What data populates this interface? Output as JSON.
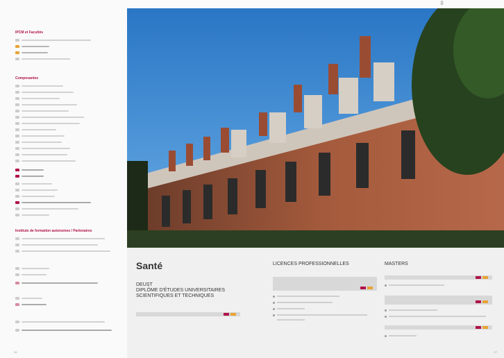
{
  "left_page": {
    "section_titles": [
      "IPCM et Facultés",
      "Composantes",
      "Instituts de formation autonomes / Partenaires"
    ],
    "page_number": "26"
  },
  "right_page": {
    "title": "Santé",
    "deust_heading": "DEUST\nDIPLÔME D'ÉTUDES UNIVERSITAIRES SCIENTIFIQUES ET TECHNIQUES",
    "col_licences": "LICENCES PROFESSIONNELLES",
    "col_masters": "MASTERS",
    "page_number": "27"
  },
  "colors": {
    "accent": "#b0124a",
    "orange": "#e8a334"
  }
}
